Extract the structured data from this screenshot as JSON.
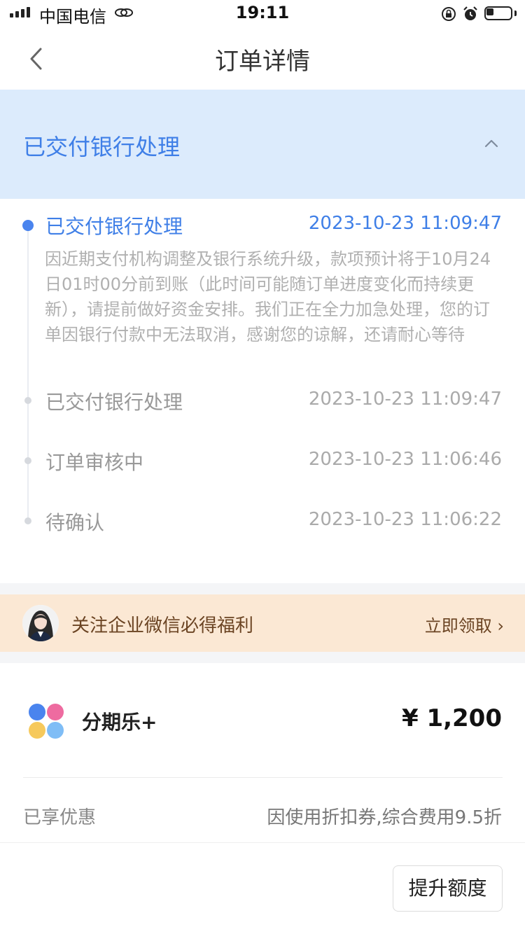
{
  "status_bar": {
    "carrier": "中国电信",
    "time": "19:11"
  },
  "nav": {
    "title": "订单详情"
  },
  "status_banner": {
    "title": "已交付银行处理"
  },
  "timeline": {
    "events": [
      {
        "title": "已交付银行处理",
        "time": "2023-10-23 11:09:47",
        "description": "因近期支付机构调整及银行系统升级，款项预计将于10月24日01时00分前到账（此时间可能随订单进度变化而持续更新），请提前做好资金安排。我们正在全力加急处理，您的订单因银行付款中无法取消，感谢您的谅解，还请耐心等待"
      },
      {
        "title": "已交付银行处理",
        "time": "2023-10-23 11:09:47"
      },
      {
        "title": "订单审核中",
        "time": "2023-10-23 11:06:46"
      },
      {
        "title": "待确认",
        "time": "2023-10-23 11:06:22"
      }
    ]
  },
  "promo": {
    "text": "关注企业微信必得福利",
    "link": "立即领取 ›"
  },
  "product": {
    "name": "分期乐+",
    "price": "¥ 1,200",
    "discount_label": "已享优惠",
    "discount_value": "因使用折扣券,综合费用9.5折"
  },
  "actions": {
    "raise_limit": "提升额度"
  },
  "colors": {
    "accent": "#3f7fe7",
    "banner_bg": "#dcebfc",
    "promo_bg": "#fbe8d4",
    "promo_text": "#6b4423"
  },
  "icons": [
    "signal-icon",
    "link-icon",
    "lock-rotation-icon",
    "alarm-icon",
    "battery-icon",
    "back-icon",
    "chevron-up-icon",
    "avatar",
    "product-logo"
  ]
}
